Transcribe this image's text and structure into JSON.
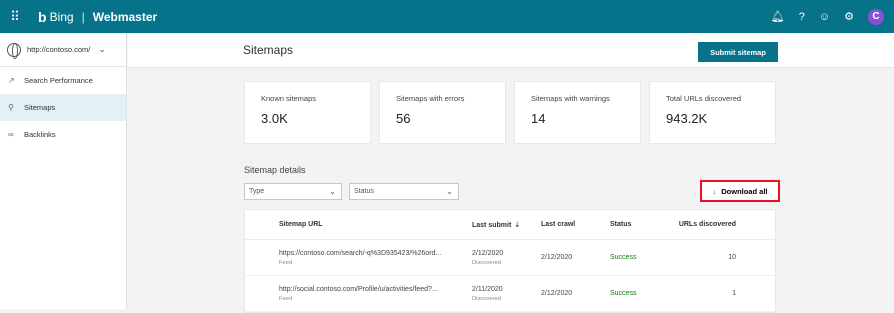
{
  "topbar": {
    "brand_logo": "b",
    "brand_name": "Bing",
    "separator": "|",
    "app_name": "Webmaster",
    "icons": [
      "bell-icon",
      "help-icon",
      "smiley-icon",
      "gear-icon"
    ],
    "avatar": "C",
    "colors": {
      "bar": "#07738a",
      "avatar": "#8a4fd9"
    }
  },
  "sidebar": {
    "site": "http://contoso.com/",
    "items": [
      {
        "label": "Search Performance",
        "icon": "trend-icon",
        "active": false
      },
      {
        "label": "Sitemaps",
        "icon": "sitemap-icon",
        "active": true
      },
      {
        "label": "Backlinks",
        "icon": "link-icon",
        "active": false
      }
    ]
  },
  "page": {
    "title": "Sitemaps",
    "submit_label": "Submit sitemap"
  },
  "cards": [
    {
      "label": "Known sitemaps",
      "value": "3.0K"
    },
    {
      "label": "Sitemaps with errors",
      "value": "56"
    },
    {
      "label": "Sitemaps with warnings",
      "value": "14"
    },
    {
      "label": "Total URLs discovered",
      "value": "943.2K"
    }
  ],
  "details": {
    "title": "Sitemap details",
    "filters": [
      {
        "label": "Type"
      },
      {
        "label": "Status"
      }
    ],
    "download_label": "Download all",
    "columns": {
      "url": "Sitemap URL",
      "submit": "Last submit",
      "crawl": "Last crawl",
      "status": "Status",
      "urls": "URLs discovered"
    },
    "rows": [
      {
        "url": "https://contoso.com/search/-q%3D935423/%26ord...",
        "type": "Feed",
        "last_submit": "2/12/2020",
        "submit_note": "Discovered",
        "last_crawl": "2/12/2020",
        "status": "Success",
        "urls": "10"
      },
      {
        "url": "http://social.contoso.com/Profile/u/activities/feed?...",
        "type": "Feed",
        "last_submit": "2/11/2020",
        "submit_note": "Discovered",
        "last_crawl": "2/12/2020",
        "status": "Success",
        "urls": "1"
      }
    ]
  }
}
